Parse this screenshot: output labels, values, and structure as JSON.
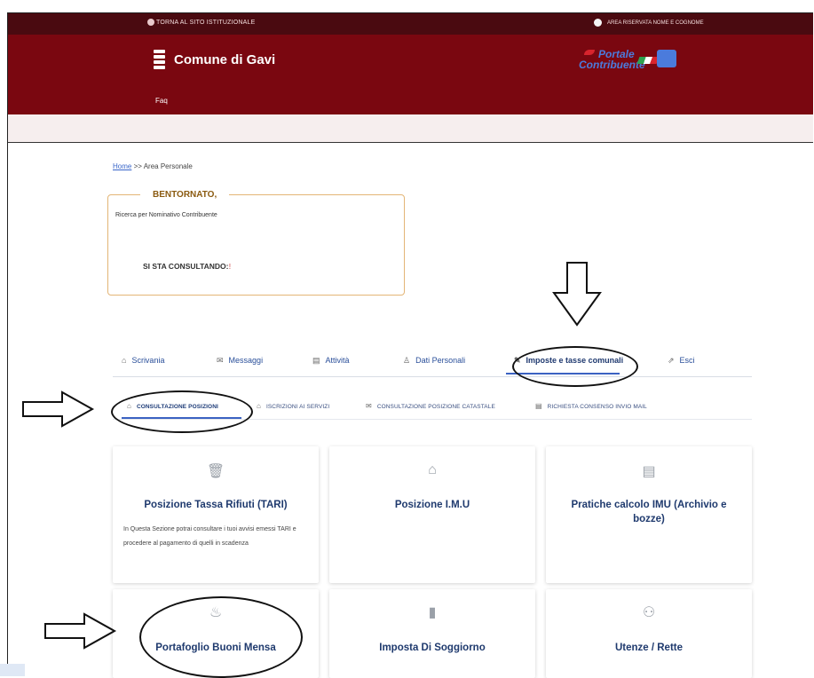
{
  "topbar": {
    "back_link": "TORNA AL SITO ISTITUZIONALE",
    "reserved_area": "AREA RISERVATA NOME E COGNOME"
  },
  "header": {
    "title": "Comune di Gavi",
    "faq": "Faq",
    "portal_logo_line1": "Portale",
    "portal_logo_line2": "Contribuente"
  },
  "breadcrumb": {
    "home": "Home",
    "separator": ">>",
    "current": "Area Personale"
  },
  "welcome": {
    "title": "BENTORNATO,",
    "subtitle": "Ricerca per Nominativo Contribuente",
    "consulting": "SI STA CONSULTANDO:",
    "consulting_mark": "!"
  },
  "tabs": [
    {
      "label": "Scrivania",
      "icon": "bank-icon"
    },
    {
      "label": "Messaggi",
      "icon": "envelope-icon"
    },
    {
      "label": "Attività",
      "icon": "clipboard-icon"
    },
    {
      "label": "Dati Personali",
      "icon": "person-icon"
    },
    {
      "label": "Imposte e tasse comunali",
      "icon": "pencil-icon"
    },
    {
      "label": "Esci",
      "icon": "external-link-icon"
    }
  ],
  "subtabs": [
    {
      "label": "CONSULTAZIONE POSIZIONI",
      "icon": "bank-icon"
    },
    {
      "label": "ISCRIZIONI AI SERVIZI",
      "icon": "bank-icon"
    },
    {
      "label": "CONSULTAZIONE POSIZIONE CATASTALE",
      "icon": "envelope-icon"
    },
    {
      "label": "RICHIESTA CONSENSO INVIO MAIL",
      "icon": "clipboard-icon"
    }
  ],
  "cards": [
    {
      "title": "Posizione Tassa Rifiuti (TARI)",
      "description": "In Questa Sezione potrai consultare i tuoi avvisi emessi TARI e procedere al pagamento di quelli in scadenza",
      "icon": "trash-icon"
    },
    {
      "title": "Posizione I.M.U",
      "description": "",
      "icon": "house-icon"
    },
    {
      "title": "Pratiche calcolo IMU (Archivio e bozze)",
      "description": "",
      "icon": "document-icon"
    },
    {
      "title": "Portafoglio Buoni Mensa",
      "description": "",
      "icon": "meal-icon"
    },
    {
      "title": "Imposta Di Soggiorno",
      "description": "",
      "icon": "luggage-icon"
    },
    {
      "title": "Utenze / Rette",
      "description": "",
      "icon": "users-icon"
    }
  ],
  "colors": {
    "header": "#7a0710",
    "topstrip": "#4a0a10",
    "accent": "#3b62c2",
    "card_title": "#1f3a6e"
  }
}
